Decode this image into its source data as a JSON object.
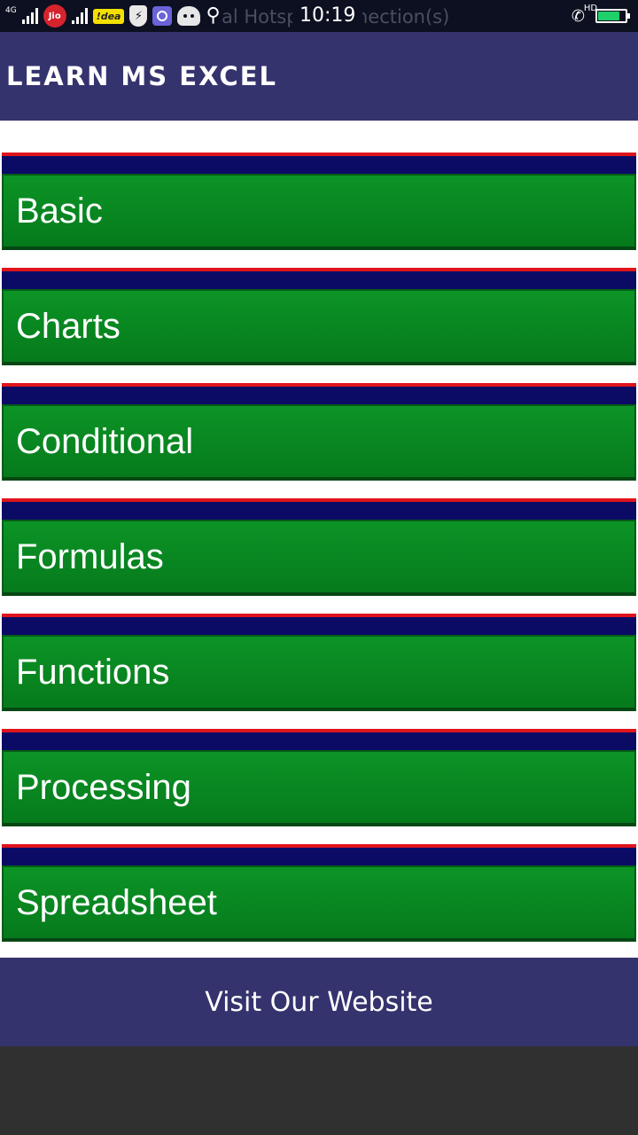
{
  "status_bar": {
    "network_type": "4G",
    "carrier_1": "Jio",
    "carrier_2": "!dea",
    "time": "10:19",
    "notification_ghost": "al Hotspot connection(s)",
    "call_badge": "HD",
    "battery_level_percent": 80
  },
  "app_bar": {
    "title": "LEARN MS EXCEL"
  },
  "menu": {
    "items": [
      {
        "label": "Basic"
      },
      {
        "label": "Charts"
      },
      {
        "label": "Conditional"
      },
      {
        "label": "Formulas"
      },
      {
        "label": "Functions"
      },
      {
        "label": "Processing"
      },
      {
        "label": "Spreadsheet"
      }
    ]
  },
  "footer": {
    "website_label": "Visit Our Website"
  },
  "colors": {
    "app_bar": "#35336e",
    "menu_button": "#0a8a24",
    "menu_header": "#0b0b66",
    "menu_accent": "#e0141c",
    "bottom_area": "#303030"
  }
}
